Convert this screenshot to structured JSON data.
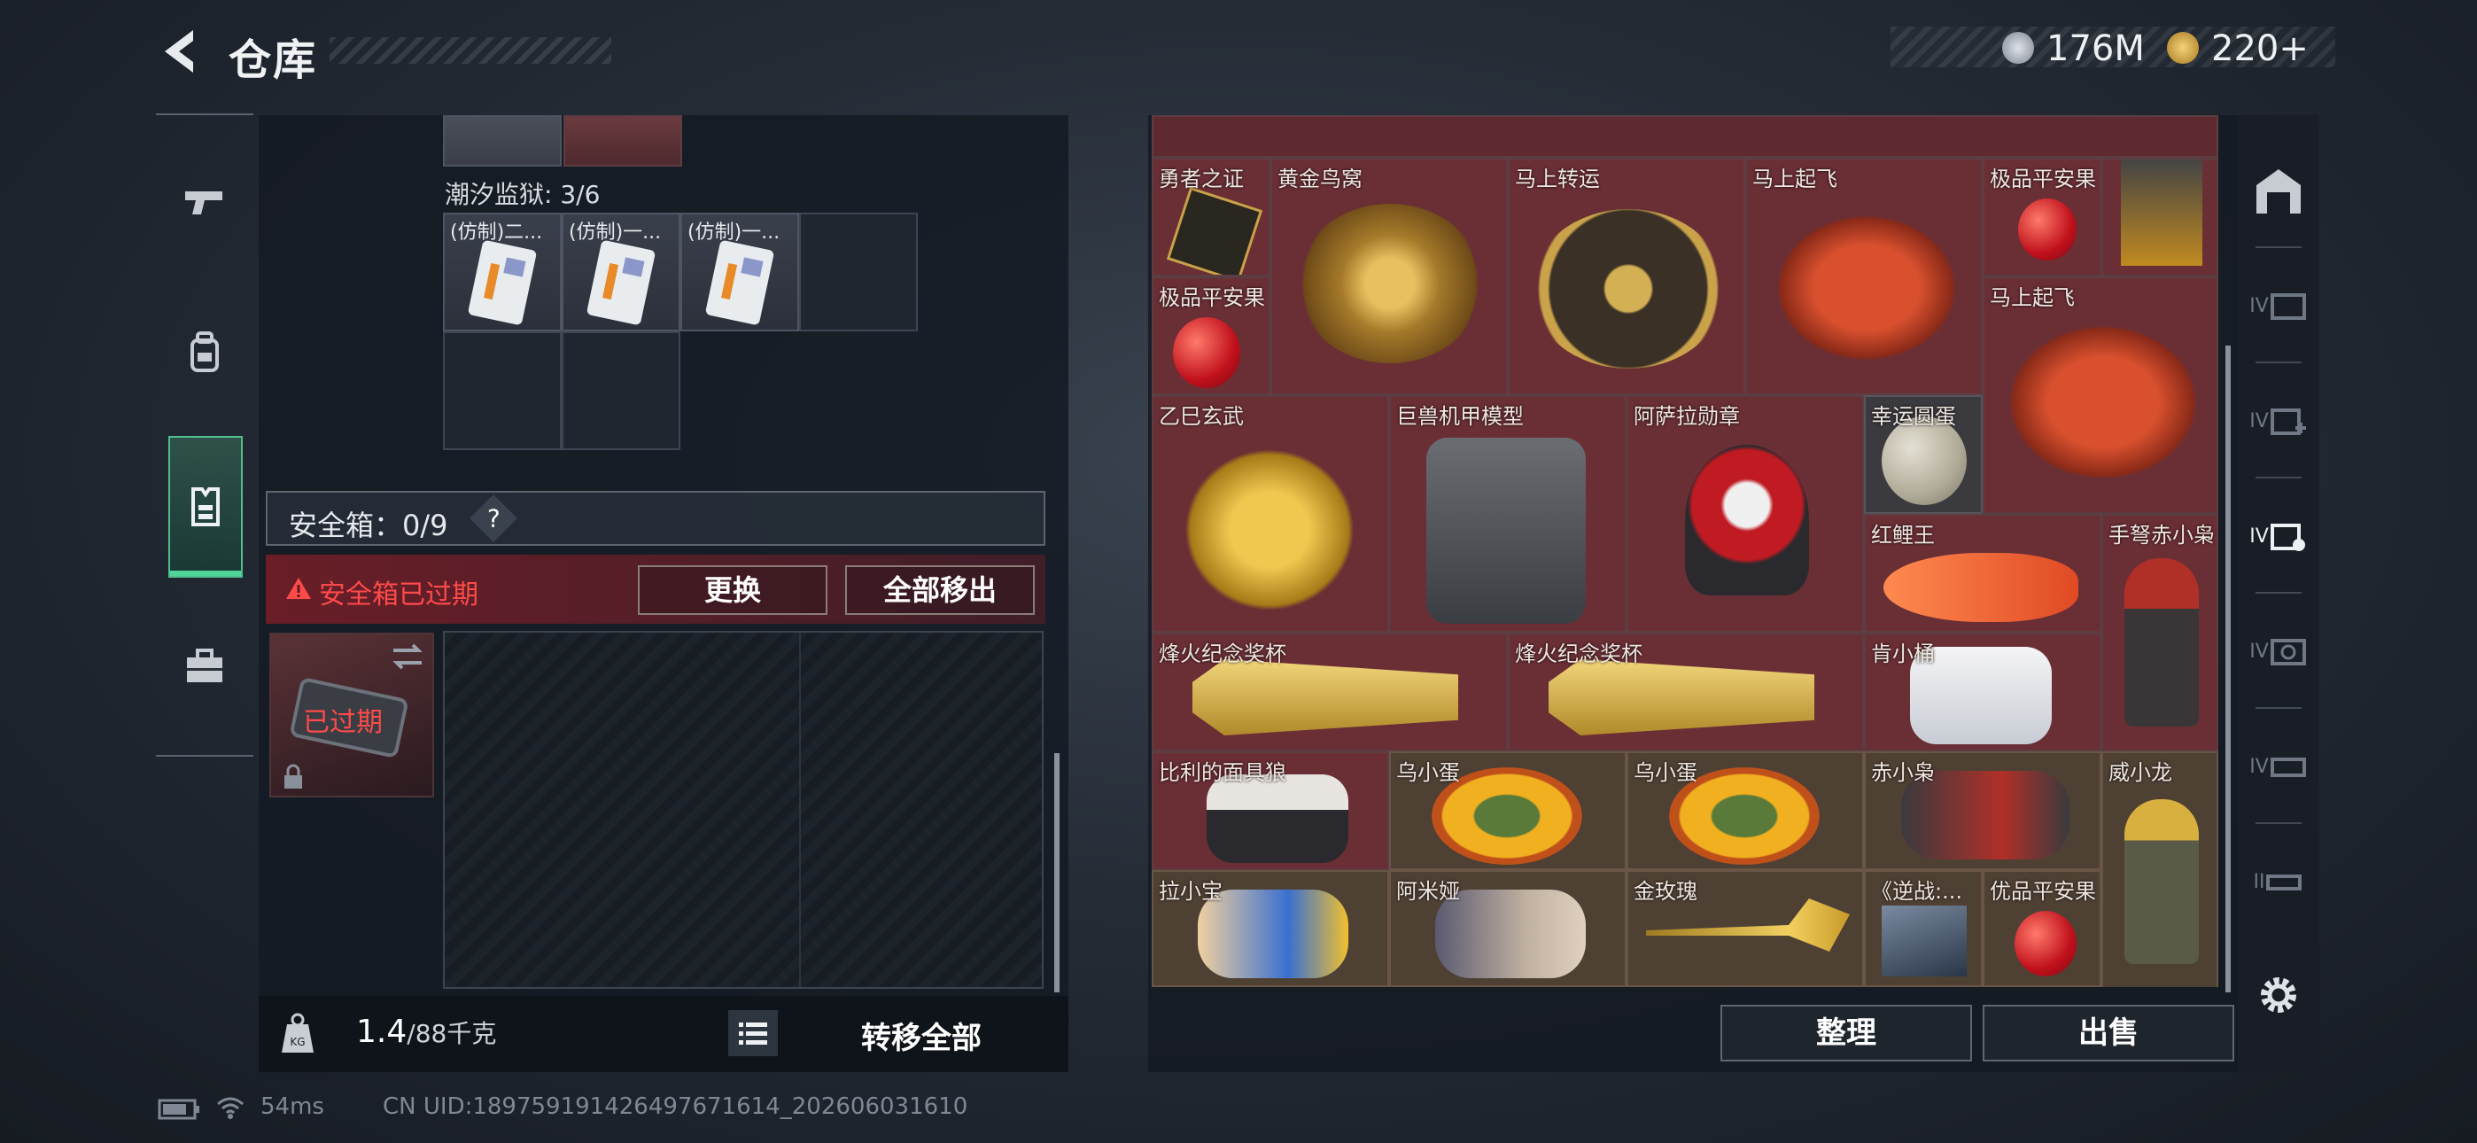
{
  "header": {
    "title": "仓库",
    "currencies": [
      {
        "icon": "silver-coin-icon",
        "value": "176M"
      },
      {
        "icon": "gold-coin-icon",
        "value": "220+"
      }
    ]
  },
  "left_nav": [
    {
      "name": "weapon",
      "icon": "pistol-icon"
    },
    {
      "name": "backpack",
      "icon": "backpack-icon"
    },
    {
      "name": "vest",
      "icon": "vest-icon",
      "active": true
    },
    {
      "name": "case",
      "icon": "briefcase-icon"
    }
  ],
  "container": {
    "label": "潮汐监狱: 3/6",
    "items": [
      {
        "label": "(仿制)二..."
      },
      {
        "label": "(仿制)一..."
      },
      {
        "label": "(仿制)一..."
      }
    ]
  },
  "safebox": {
    "label": "安全箱：0/9",
    "help": "?",
    "warning": "安全箱已过期",
    "replace_label": "更换",
    "remove_all_label": "全部移出",
    "slot_status": "已过期"
  },
  "weight": {
    "current": "1.4",
    "max": "/88千克",
    "transfer_all_label": "转移全部"
  },
  "inventory": {
    "items": [
      {
        "label": "勇者之证",
        "color": "red"
      },
      {
        "label": "黄金鸟窝",
        "color": "red"
      },
      {
        "label": "马上转运",
        "color": "red"
      },
      {
        "label": "马上起飞",
        "color": "red"
      },
      {
        "label": "极品平安果",
        "color": "red"
      },
      {
        "label": "极品平安果",
        "color": "red"
      },
      {
        "label": "马上起飞",
        "color": "red"
      },
      {
        "label": "乙巳玄武",
        "color": "red"
      },
      {
        "label": "巨兽机甲模型",
        "color": "red"
      },
      {
        "label": "阿萨拉勋章",
        "color": "red"
      },
      {
        "label": "幸运圆蛋",
        "color": "grey"
      },
      {
        "label": "红鲤王",
        "color": "red"
      },
      {
        "label": "手弩赤小枭",
        "color": "red"
      },
      {
        "label": "烽火纪念奖杯",
        "color": "red"
      },
      {
        "label": "烽火纪念奖杯",
        "color": "red"
      },
      {
        "label": "肯小桶",
        "color": "red"
      },
      {
        "label": "比利的面具狼",
        "color": "red"
      },
      {
        "label": "乌小蛋",
        "color": "gold"
      },
      {
        "label": "乌小蛋",
        "color": "gold"
      },
      {
        "label": "赤小枭",
        "color": "gold"
      },
      {
        "label": "威小龙",
        "color": "gold"
      },
      {
        "label": "拉小宝",
        "color": "gold"
      },
      {
        "label": "阿米娅",
        "color": "gold"
      },
      {
        "label": "金玫瑰",
        "color": "gold"
      },
      {
        "label": "《逆战:...",
        "color": "gold"
      },
      {
        "label": "优品平安果",
        "color": "gold"
      }
    ],
    "sort_label": "整理",
    "sell_label": "出售"
  },
  "right_nav": [
    "IV",
    "IV",
    "IV",
    "IV",
    "IV",
    "II"
  ],
  "footer": {
    "ping": "54ms",
    "uid": "CN UID:1897591914264976716​14_202606031610"
  },
  "colors": {
    "accent_green": "#4fd59a",
    "warning_red": "#ff4a4a",
    "item_red_bg": "#6a2f35",
    "item_gold_bg": "#4f4034"
  }
}
